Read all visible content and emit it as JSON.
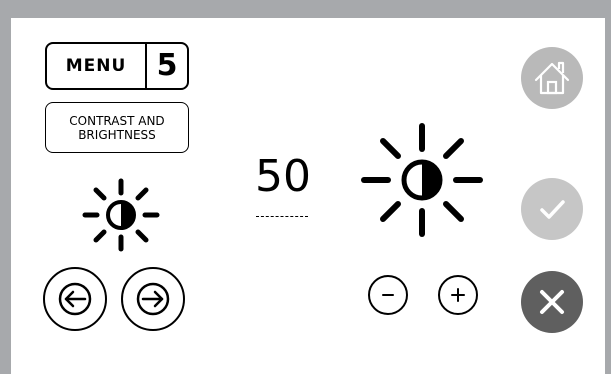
{
  "menu": {
    "label": "MENU",
    "number": "5"
  },
  "screen": {
    "title_line1": "CONTRAST AND",
    "title_line2": "BRIGHTNESS"
  },
  "setting": {
    "value": "50"
  },
  "icons": {
    "contrast_small": "contrast-brightness-icon",
    "contrast_large": "contrast-brightness-icon",
    "prev": "arrow-left-circle-icon",
    "next": "arrow-right-circle-icon",
    "decrease": "minus-circle-icon",
    "increase": "plus-circle-icon",
    "home": "home-icon",
    "confirm": "checkmark-icon",
    "cancel": "close-icon"
  },
  "colors": {
    "frame": "#a7a9ac",
    "home_button": "#b9b9b9",
    "confirm_button": "#c6c6c6",
    "cancel_button": "#5f5f5f"
  }
}
